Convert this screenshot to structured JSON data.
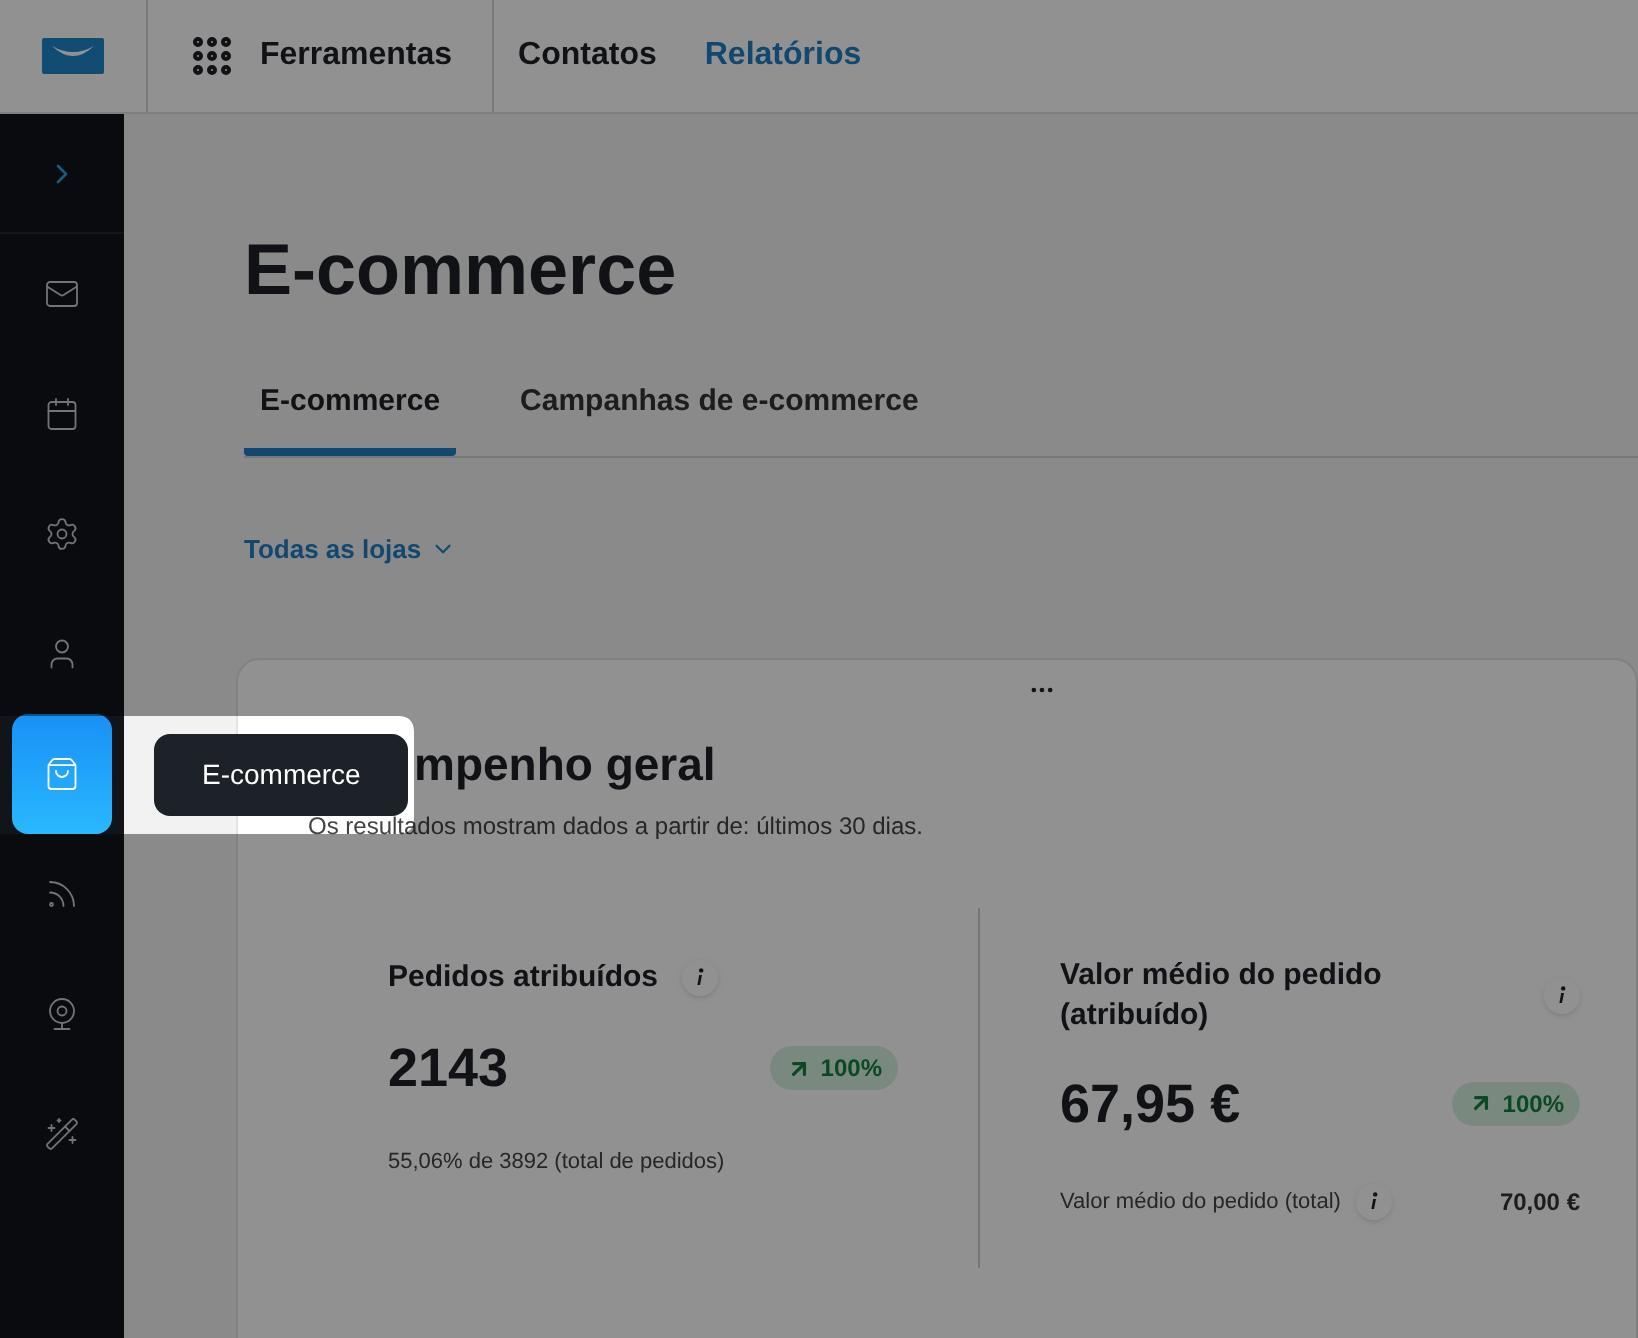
{
  "header": {
    "tools_label": "Ferramentas",
    "nav": [
      {
        "label": "Contatos",
        "selected": false
      },
      {
        "label": "Relatórios",
        "selected": true
      }
    ]
  },
  "sidebar": {
    "items": [
      {
        "selected": false
      },
      {
        "selected": false
      },
      {
        "selected": false
      },
      {
        "selected": false
      },
      {
        "selected": true
      },
      {
        "selected": false
      },
      {
        "selected": false
      },
      {
        "selected": false
      }
    ]
  },
  "tooltip": "E-commerce",
  "page_title": "E-commerce",
  "tabs": [
    {
      "label": "E-commerce",
      "selected": true
    },
    {
      "label": "Campanhas de e-commerce",
      "selected": false
    }
  ],
  "store_filter": "Todas as lojas",
  "card": {
    "title": "mpenho geral",
    "subtitle": "Os resultados mostram dados a partir de: últimos 30 dias.",
    "metrics": [
      {
        "label": "Pedidos atribuídos",
        "value": "2143",
        "change": "100%",
        "footnote": "55,06% de 3892 (total de pedidos)"
      },
      {
        "label": "Valor médio do pedido (atribuído)",
        "value": "67,95 €",
        "change": "100%",
        "footnote": "Valor médio do pedido (total)",
        "footnote_value": "70,00 €"
      }
    ]
  }
}
